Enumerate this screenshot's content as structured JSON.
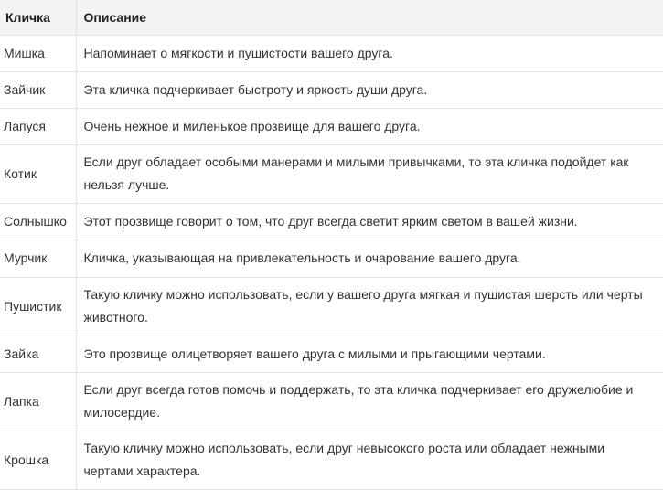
{
  "table": {
    "headers": [
      "Кличка",
      "Описание"
    ],
    "rows": [
      {
        "name": "Мишка",
        "description": "Напоминает о мягкости и пушистости вашего друга."
      },
      {
        "name": "Зайчик",
        "description": "Эта кличка подчеркивает быстроту и яркость души друга."
      },
      {
        "name": "Лапуся",
        "description": "Очень нежное и миленькое прозвище для вашего друга."
      },
      {
        "name": "Котик",
        "description": "Если друг обладает особыми манерами и милыми привычками, то эта кличка подойдет как нельзя лучше."
      },
      {
        "name": "Солнышко",
        "description": "Этот прозвище говорит о том, что друг всегда светит ярким светом в вашей жизни."
      },
      {
        "name": "Мурчик",
        "description": "Кличка, указывающая на привлекательность и очарование вашего друга."
      },
      {
        "name": "Пушистик",
        "description": "Такую кличку можно использовать, если у вашего друга мягкая и пушистая шерсть или черты животного."
      },
      {
        "name": "Зайка",
        "description": "Это прозвище олицетворяет вашего друга с милыми и прыгающими чертами."
      },
      {
        "name": "Лапка",
        "description": "Если друг всегда готов помочь и поддержать, то эта кличка подчеркивает его дружелюбие и милосердие."
      },
      {
        "name": "Крошка",
        "description": "Такую кличку можно использовать, если друг невысокого роста или обладает нежными чертами характера."
      }
    ]
  }
}
